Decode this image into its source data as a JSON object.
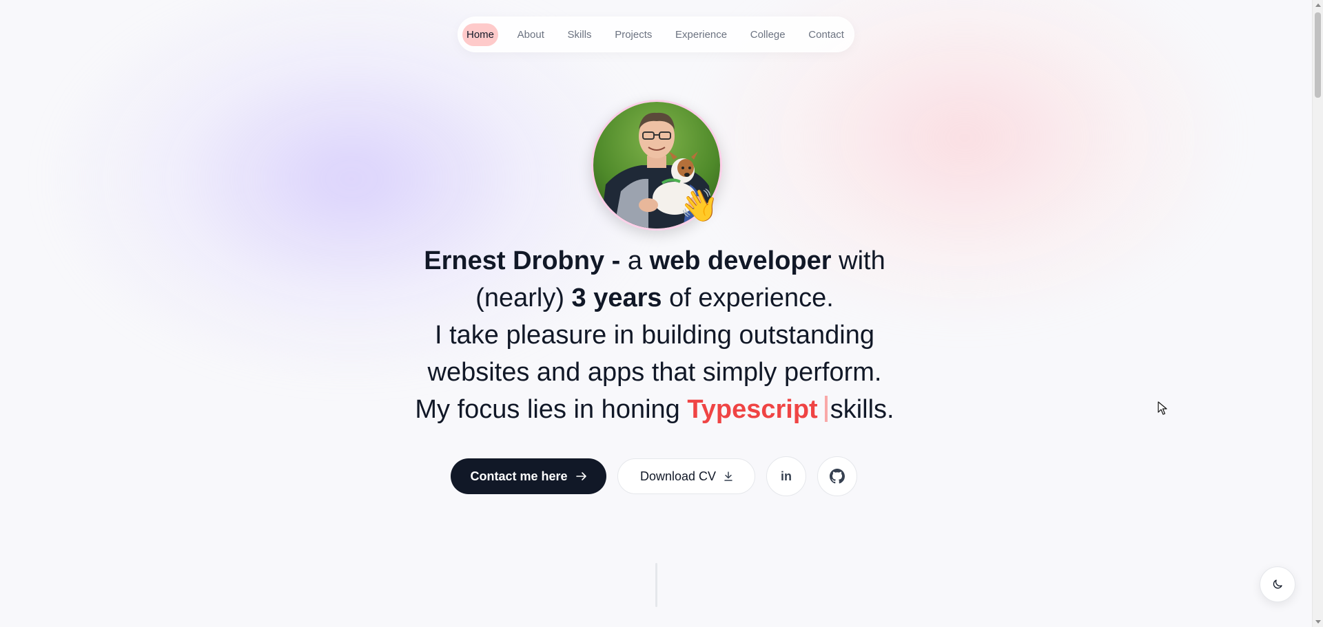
{
  "nav": {
    "items": [
      {
        "label": "Home",
        "active": true
      },
      {
        "label": "About"
      },
      {
        "label": "Skills"
      },
      {
        "label": "Projects"
      },
      {
        "label": "Experience"
      },
      {
        "label": "College"
      },
      {
        "label": "Contact"
      }
    ]
  },
  "hero": {
    "avatar_icon": "profile-photo",
    "wave_emoji": "👋",
    "line1": {
      "name": "Ernest Drobny -",
      "a": " a ",
      "role": "web developer",
      "with": " with"
    },
    "line2": {
      "pre": "(nearly) ",
      "years": "3 years",
      "post": " of experience."
    },
    "line3": "I take pleasure in building outstanding",
    "line4": "websites and apps that simply perform.",
    "line5": {
      "pre": "My focus lies in honing ",
      "skill": "Typescript",
      "post": "skills."
    }
  },
  "actions": {
    "contact_label": "Contact me here",
    "contact_icon": "arrow-right-icon",
    "download_label": "Download CV",
    "download_icon": "download-icon",
    "linkedin_label": "in",
    "github_icon": "github-icon"
  },
  "theme": {
    "toggle_icon": "moon-icon"
  },
  "colors": {
    "accent": "#ef4444",
    "primary_button": "#111827",
    "active_nav": "#fecaca"
  }
}
